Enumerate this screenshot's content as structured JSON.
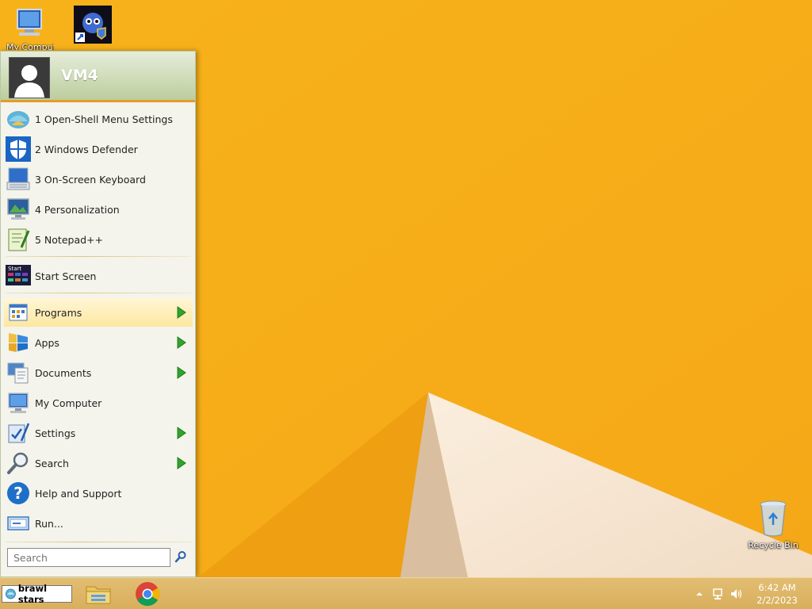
{
  "desktop": {
    "icons": [
      {
        "label": "My Computer",
        "icon": "computer-icon"
      },
      {
        "label": "",
        "icon": "app-shortcut-icon"
      },
      {
        "label": "Recycle Bin",
        "icon": "recycle-bin-icon"
      }
    ]
  },
  "start_menu": {
    "user_name": "VM4",
    "recent": [
      {
        "label": "1 Open-Shell Menu Settings",
        "icon": "shell-settings-icon"
      },
      {
        "label": "2 Windows Defender",
        "icon": "shield-icon"
      },
      {
        "label": "3 On-Screen Keyboard",
        "icon": "keyboard-icon"
      },
      {
        "label": "4 Personalization",
        "icon": "personalization-icon"
      },
      {
        "label": "5 Notepad++",
        "icon": "notepad-icon"
      }
    ],
    "start_screen": {
      "label": "Start Screen",
      "icon": "start-screen-icon"
    },
    "main": [
      {
        "label": "Programs",
        "icon": "programs-icon",
        "submenu": true,
        "highlighted": true
      },
      {
        "label": "Apps",
        "icon": "apps-icon",
        "submenu": true
      },
      {
        "label": "Documents",
        "icon": "documents-icon",
        "submenu": true
      },
      {
        "label": "My Computer",
        "icon": "computer-icon",
        "submenu": false
      },
      {
        "label": "Settings",
        "icon": "settings-icon",
        "submenu": true
      },
      {
        "label": "Search",
        "icon": "search-icon",
        "submenu": true
      },
      {
        "label": "Help and Support",
        "icon": "help-icon",
        "submenu": false
      },
      {
        "label": "Run...",
        "icon": "run-icon",
        "submenu": false
      }
    ],
    "search_placeholder": "Search"
  },
  "taskbar": {
    "start_label": "brawl stars",
    "pinned": [
      {
        "icon": "file-explorer-icon"
      },
      {
        "icon": "chrome-icon"
      }
    ],
    "clock": {
      "time": "6:42 AM",
      "date": "2/2/2023"
    }
  },
  "colors": {
    "wallpaper": "#f7b21a",
    "menu_background": "#f4f4ec",
    "menu_accent": "#e59a2c",
    "highlight": "#fde7a0",
    "submenu_arrow": "#2fa52a"
  }
}
